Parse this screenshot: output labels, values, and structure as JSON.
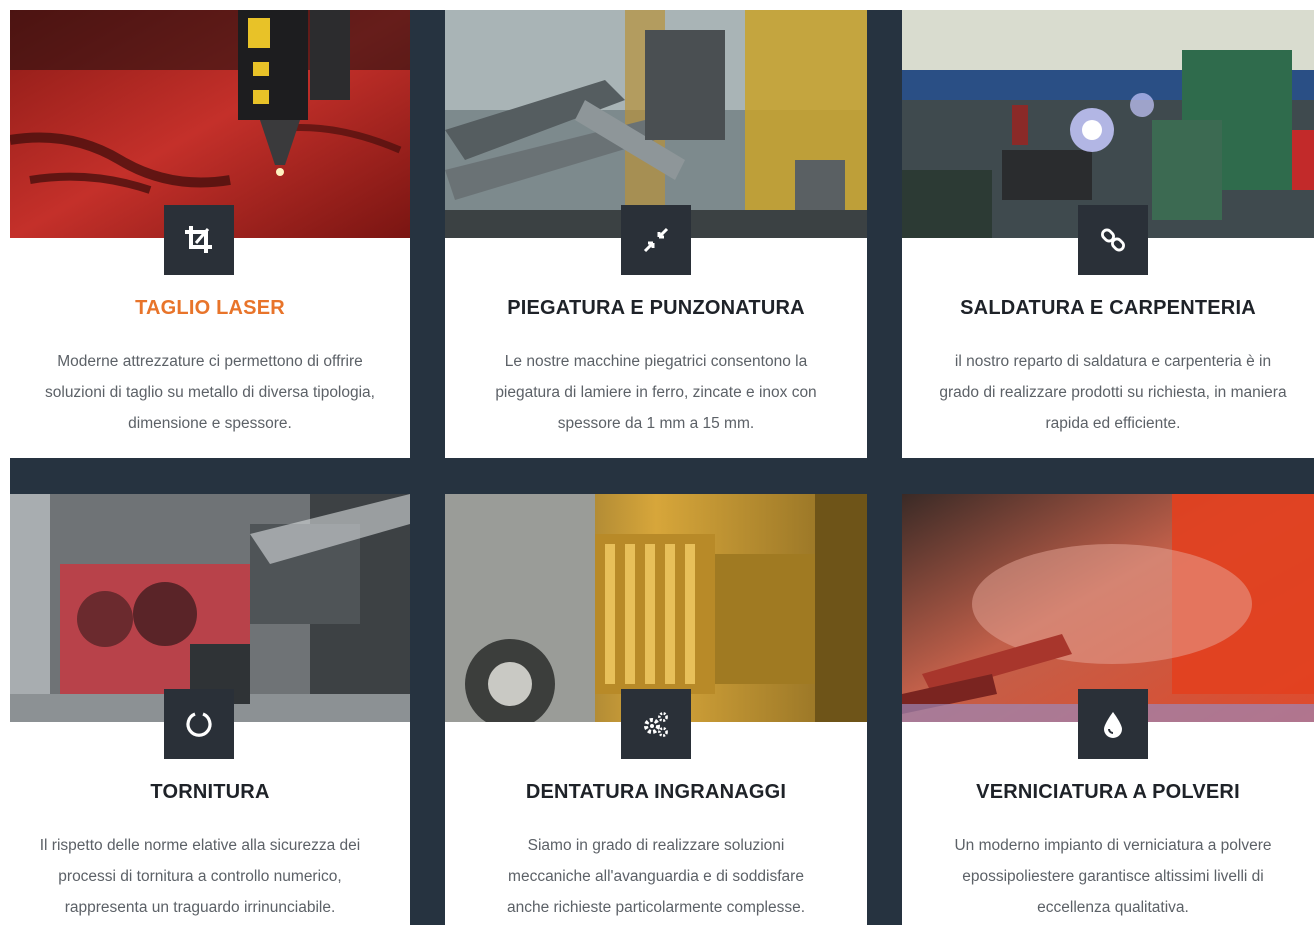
{
  "services": [
    {
      "id": "taglio-laser",
      "title": "TAGLIO LASER",
      "icon": "crop-icon",
      "active": true,
      "text": "Moderne attrezzature ci permettono di offrire soluzioni di taglio su metallo di diversa tipologia, dimensione e spessore."
    },
    {
      "id": "piegatura",
      "title": "PIEGATURA E PUNZONATURA",
      "icon": "compress-arrows-icon",
      "active": false,
      "text": "Le nostre macchine piegatrici consentono la piegatura di lamiere in ferro, zincate e inox con spessore da 1 mm a 15 mm."
    },
    {
      "id": "saldatura",
      "title": "SALDATURA E CARPENTERIA",
      "icon": "chain-link-icon",
      "active": false,
      "text": "il nostro reparto di saldatura e carpenteria è in grado di realizzare prodotti su richiesta, in maniera rapida ed efficiente."
    },
    {
      "id": "tornitura",
      "title": "TORNITURA",
      "icon": "circle-notch-icon",
      "active": false,
      "text": "Il rispetto delle norme elative alla sicurezza dei processi di tornitura a controllo numerico, rappresenta un traguardo irrinunciabile."
    },
    {
      "id": "dentatura",
      "title": "DENTATURA INGRANAGGI",
      "icon": "gears-icon",
      "active": false,
      "text": "Siamo in grado di realizzare soluzioni meccaniche all'avanguardia e di soddisfare anche richieste particolarmente complesse."
    },
    {
      "id": "verniciatura",
      "title": "VERNICIATURA A POLVERI",
      "icon": "drop-icon",
      "active": false,
      "text": "Un moderno impianto di verniciatura a polvere epossipoliestere garantisce altissimi livelli di eccellenza qualitativa."
    }
  ],
  "colors": {
    "background": "#263340",
    "card": "#ffffff",
    "icon_box": "#2a3038",
    "title": "#1e2228",
    "title_active": "#e8742a",
    "body_text": "#5c6167"
  }
}
